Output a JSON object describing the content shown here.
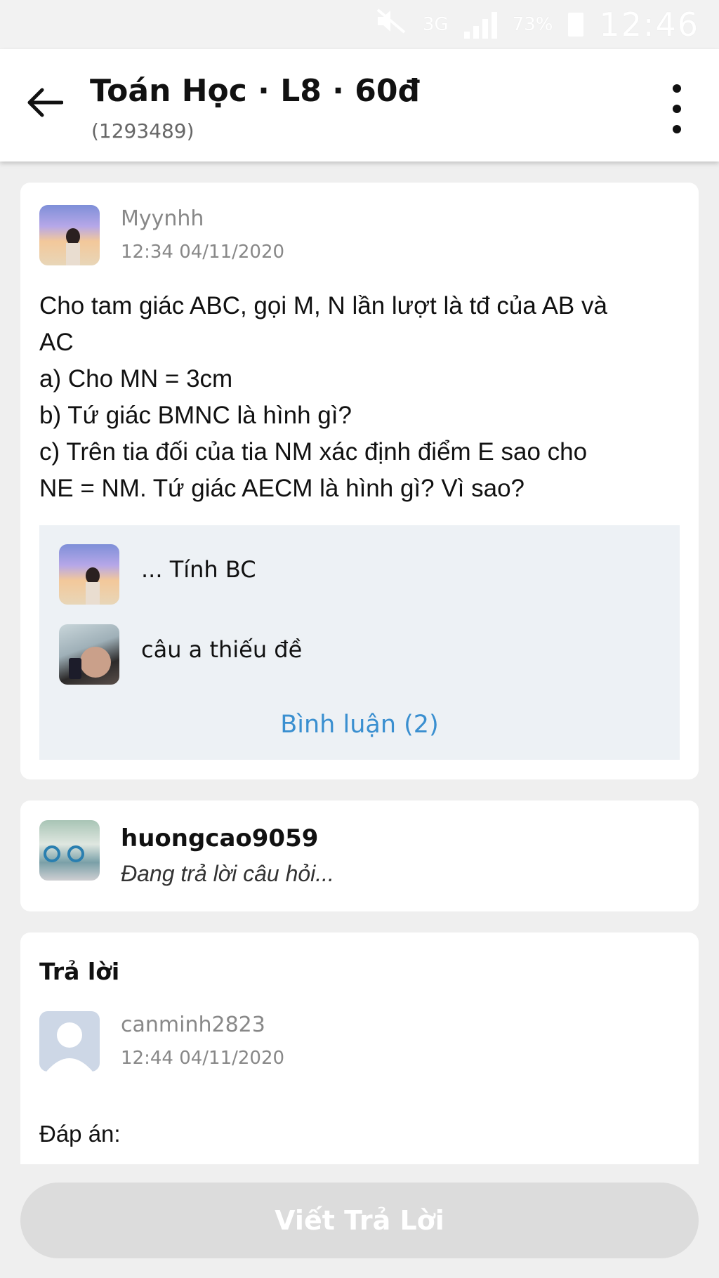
{
  "status_bar": {
    "network": "3G",
    "battery": "73%",
    "time": "12:46"
  },
  "header": {
    "title": "Toán Học · L8 · 60đ",
    "subtitle": "(1293489)"
  },
  "question": {
    "author": "Myynhh",
    "time": "12:34 04/11/2020",
    "lines": [
      "Cho tam giác ABC, gọi M, N lần lượt là tđ của AB và",
      "AC",
      "a) Cho MN = 3cm",
      "b) Tứ giác BMNC là hình gì?",
      "c) Trên tia đối của tia NM xác định điểm E sao cho",
      "NE = NM. Tứ giác AECM là hình gì? Vì sao?"
    ],
    "comments": [
      {
        "text": "... Tính BC"
      },
      {
        "text": "câu a thiếu đề"
      }
    ],
    "comments_link": "Bình luận (2)"
  },
  "typing": {
    "user": "huongcao9059",
    "status": "Đang trả lời câu hỏi..."
  },
  "answer": {
    "heading": "Trả lời",
    "author": "canminh2823",
    "time": "12:44 04/11/2020",
    "label": "Đáp án:"
  },
  "footer": {
    "write_button": "Viết Trả Lời"
  },
  "colors": {
    "link": "#3a8fd0",
    "comment_bg": "#edf1f5",
    "button_disabled": "#dcdcdc"
  }
}
